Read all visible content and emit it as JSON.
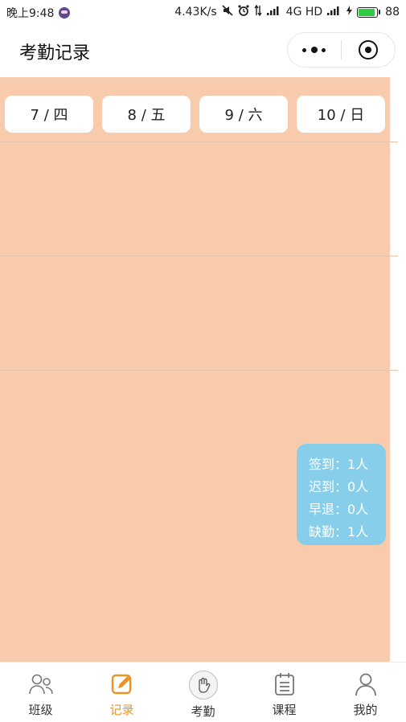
{
  "status_bar": {
    "time": "晚上9:48",
    "net_speed": "4.43K/s",
    "signal_text": "4G HD",
    "battery": "88",
    "battery_level": 0.88,
    "battery_color": "#2ecc40",
    "icons": [
      "mascot-icon",
      "mute-icon",
      "alarm-icon",
      "data-arrows-icon",
      "signal-icon",
      "battery-icon"
    ]
  },
  "nav": {
    "title": "考勤记录",
    "icons": [
      "more-dots-icon",
      "close-target-icon"
    ]
  },
  "days": [
    {
      "label": "7 / 四"
    },
    {
      "label": "8 / 五"
    },
    {
      "label": "9 / 六"
    },
    {
      "label": "10 / 日"
    }
  ],
  "stats": {
    "signed": "签到：1人",
    "late": "迟到：0人",
    "early_leave": "早退：0人",
    "absent": "缺勤：1人"
  },
  "colors": {
    "content_bg": "#f8cbad",
    "stats_bg": "#87ceeb",
    "active_tab": "#f0931e"
  },
  "tabs": [
    {
      "label": "班级",
      "icon": "people-icon"
    },
    {
      "label": "记录",
      "icon": "edit-record-icon",
      "active": true
    },
    {
      "label": "考勤",
      "icon": "attendance-hand-icon"
    },
    {
      "label": "课程",
      "icon": "clipboard-icon"
    },
    {
      "label": "我的",
      "icon": "person-icon"
    }
  ]
}
